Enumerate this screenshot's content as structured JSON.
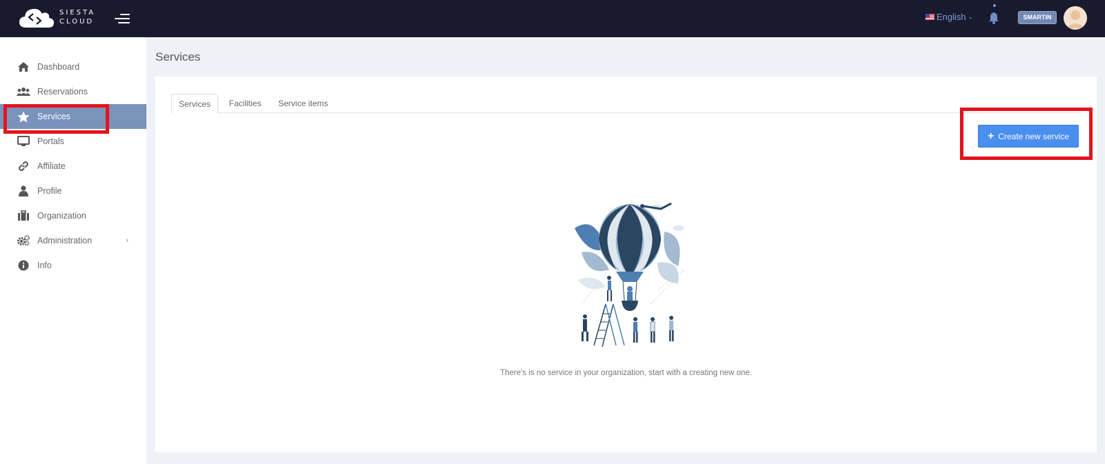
{
  "header": {
    "logo_line1": "SIESTA",
    "logo_line2": "CLOUD",
    "language": "English",
    "username": "SMARTIN"
  },
  "sidebar": {
    "items": [
      {
        "label": "Dashboard",
        "icon": "home-icon"
      },
      {
        "label": "Reservations",
        "icon": "users-icon"
      },
      {
        "label": "Services",
        "icon": "star-icon",
        "active": true
      },
      {
        "label": "Portals",
        "icon": "monitor-icon"
      },
      {
        "label": "Affiliate",
        "icon": "link-icon"
      },
      {
        "label": "Profile",
        "icon": "user-icon"
      },
      {
        "label": "Organization",
        "icon": "briefcase-icon"
      },
      {
        "label": "Administration",
        "icon": "gears-icon",
        "has_submenu": true
      },
      {
        "label": "Info",
        "icon": "info-icon"
      }
    ]
  },
  "main": {
    "title": "Services",
    "tabs": [
      {
        "label": "Services",
        "active": true
      },
      {
        "label": "Facilities"
      },
      {
        "label": "Service items"
      }
    ],
    "create_button": "Create new service",
    "empty_message": "There's is no service in your organization, start with a creating new one."
  },
  "colors": {
    "topbar": "#1a1a2e",
    "active_nav": "#7a93bd",
    "primary_button": "#4a8ef0",
    "highlight": "#e3141c"
  }
}
